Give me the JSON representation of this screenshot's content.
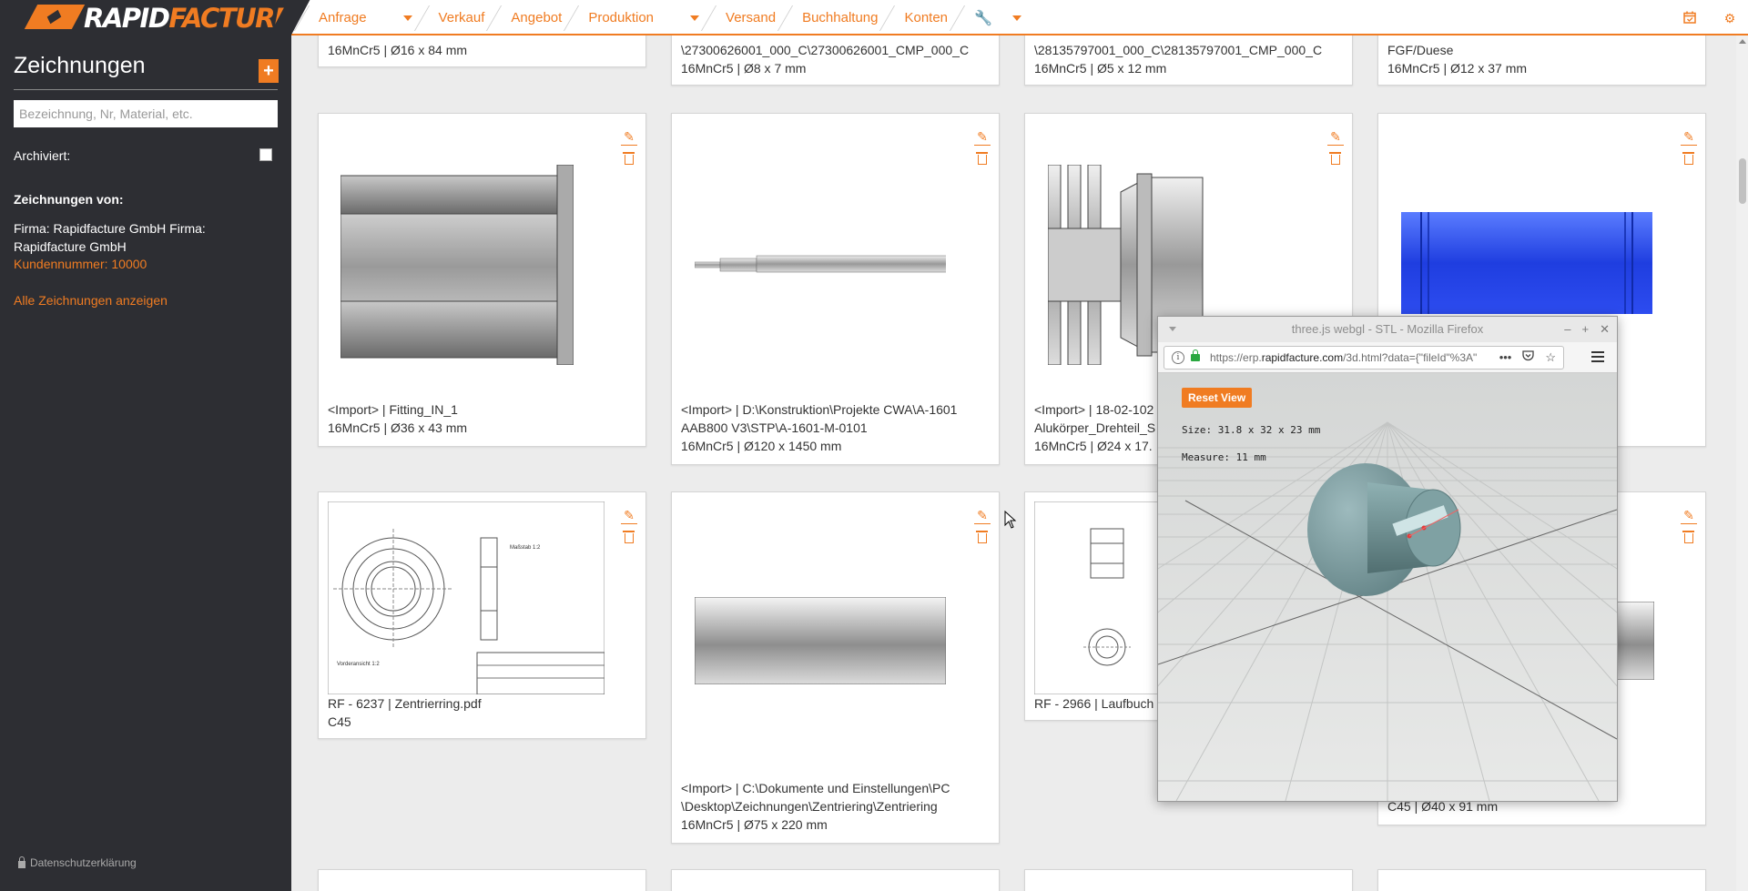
{
  "brand": {
    "part1": "RAPID",
    "part2": "FACTURE"
  },
  "nav": [
    {
      "label": "Anfrage",
      "caret": true
    },
    {
      "label": "Verkauf",
      "caret": false
    },
    {
      "label": "Angebot",
      "caret": false
    },
    {
      "label": "Produktion",
      "caret": true
    },
    {
      "label": "Versand",
      "caret": false
    },
    {
      "label": "Buchhaltung",
      "caret": false
    },
    {
      "label": "Konten",
      "caret": false
    }
  ],
  "sidebar": {
    "title": "Zeichnungen",
    "add_label": "+",
    "search_placeholder": "Bezeichnung, Nr, Material, etc.",
    "archived_label": "Archiviert:",
    "from_label": "Zeichnungen von:",
    "firma": "Firma: Rapidfacture GmbH Firma: Rapidfacture GmbH",
    "kundennummer": "Kundennummer: 10000",
    "show_all": "Alle Zeichnungen anzeigen",
    "footer": "Datenschutzerklärung"
  },
  "cards_top": [
    {
      "line1": "",
      "line2": "16MnCr5 | Ø16 x 84 mm"
    },
    {
      "line1": "\\27300626001_000_C\\27300626001_CMP_000_C",
      "line2": "16MnCr5 | Ø8 x 7 mm"
    },
    {
      "line1": "\\28135797001_000_C\\28135797001_CMP_000_C",
      "line2": "16MnCr5 | Ø5 x 12 mm"
    },
    {
      "line1": "FGF/Duese",
      "line2": "16MnCr5 | Ø12 x 37 mm"
    }
  ],
  "cards_row1": [
    {
      "line1": "<Import> | Fitting_IN_1",
      "line2": "16MnCr5 | Ø36 x 43 mm",
      "line3": ""
    },
    {
      "line1": "<Import> | D:\\Konstruktion\\Projekte CWA\\A-1601",
      "line2": "AAB800 V3\\STP\\A-1601-M-0101",
      "line3": "16MnCr5 | Ø120 x 1450 mm"
    },
    {
      "line1": "<Import> | 18-02-102",
      "line2": "Alukörper_Drehteil_S",
      "line3": "16MnCr5 | Ø24 x 17."
    },
    {
      "line1": "",
      "line2": "",
      "line3": ""
    }
  ],
  "cards_row2": [
    {
      "line1": "RF - 6237 | Zentrierring.pdf",
      "line2": "C45",
      "line3": ""
    },
    {
      "line1": "<Import> | C:\\Dokumente und Einstellungen\\PC",
      "line2": "\\Desktop\\Zeichnungen\\Zentriering\\Zentriering",
      "line3": "16MnCr5 | Ø75 x 220 mm"
    },
    {
      "line1": "RF - 2966 | Laufbuch",
      "line2": "",
      "line3": ""
    },
    {
      "line1": "C45 | Ø40 x 91 mm",
      "line2": "",
      "line3": ""
    }
  ],
  "firefox": {
    "title": "three.js webgl - STL - Mozilla Firefox",
    "url_prefix": "https://erp.",
    "url_host": "rapidfacture.com",
    "url_path": "/3d.html?data={\"fileId\"%3A\"",
    "reset_label": "Reset View",
    "size_text": "Size: 31.8 x 32 x 23 mm",
    "measure_text": "Measure: 11 mm"
  },
  "colors": {
    "accent": "#f07c22",
    "sidebar": "#2d2e33",
    "blue_part": "#1f3ee0"
  }
}
